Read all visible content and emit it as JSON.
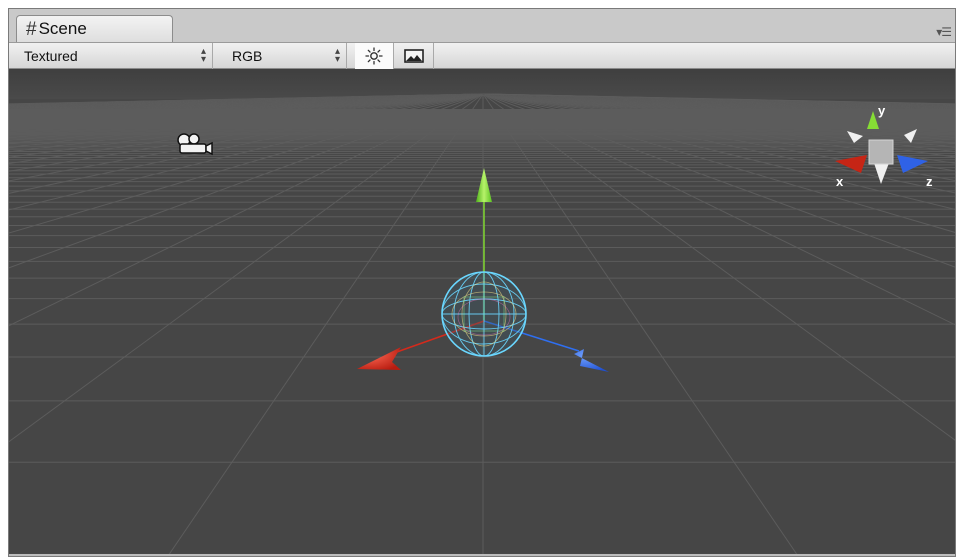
{
  "window": {
    "tab_label": "Scene",
    "tab_icon": "hash-icon",
    "menu_icon": "panel-menu-icon"
  },
  "toolbar": {
    "draw_mode": {
      "value": "Textured",
      "icon": "up-down-arrows-icon"
    },
    "render_mode": {
      "value": "RGB",
      "icon": "up-down-arrows-icon"
    },
    "lighting_toggle": {
      "icon": "sun-icon",
      "active": true
    },
    "overlay_toggle": {
      "icon": "image-icon",
      "active": false
    }
  },
  "viewport": {
    "background": "#464646",
    "grid_color": "#5c5c5c",
    "camera_icon": "camera-icon",
    "gizmo": {
      "object": "sphere-wireframe",
      "x_axis_color": "#d42a1c",
      "y_axis_color": "#7ed62f",
      "z_axis_color": "#2f6ff0",
      "sphere_color": "#6ad7ff"
    },
    "orientation": {
      "x_label": "x",
      "y_label": "y",
      "z_label": "z"
    }
  }
}
